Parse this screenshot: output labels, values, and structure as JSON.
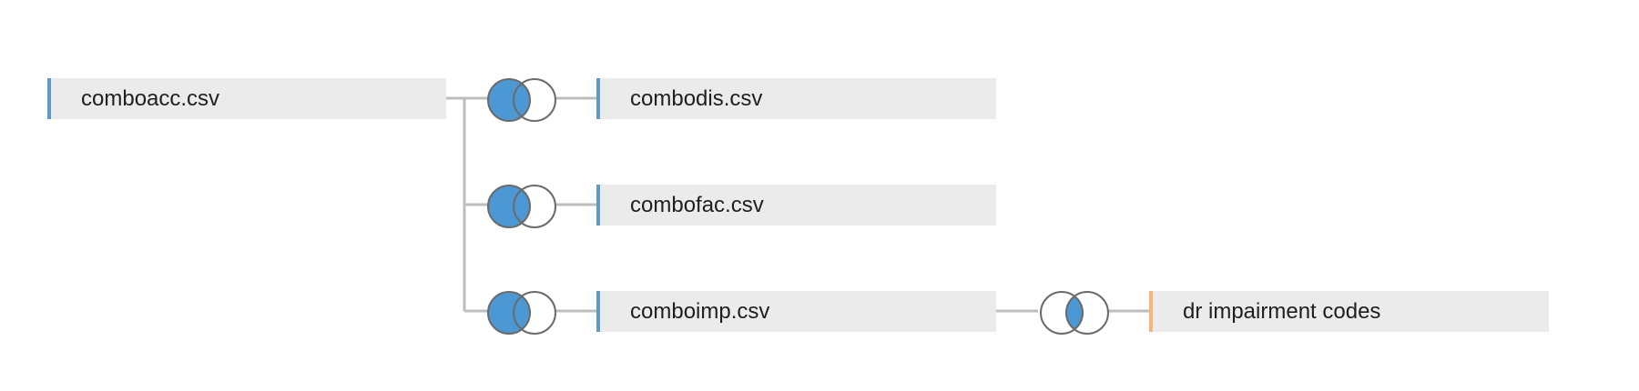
{
  "tables": [
    {
      "id": "comboacc",
      "name": "comboacc.csv",
      "kind": "csv"
    },
    {
      "id": "combodis",
      "name": "combodis.csv",
      "kind": "csv"
    },
    {
      "id": "combofac",
      "name": "combofac.csv",
      "kind": "csv"
    },
    {
      "id": "comboimp",
      "name": "comboimp.csv",
      "kind": "csv"
    },
    {
      "id": "dr-impairment-codes",
      "name": "dr impairment codes",
      "kind": "other"
    }
  ],
  "joins": [
    {
      "left": "comboacc",
      "right": "combodis",
      "type": "left-join",
      "icon": "left-join-icon"
    },
    {
      "left": "comboacc",
      "right": "combofac",
      "type": "left-join",
      "icon": "left-join-icon"
    },
    {
      "left": "comboacc",
      "right": "comboimp",
      "type": "left-join",
      "icon": "left-join-icon"
    },
    {
      "left": "comboimp",
      "right": "dr-impairment-codes",
      "type": "inner-join",
      "icon": "inner-join-icon"
    }
  ],
  "colors": {
    "csv_accent": "#5b9bc7",
    "other_accent": "#f3b779",
    "join_fill": "#4b98d4",
    "join_stroke": "#6b6b6b",
    "connector": "#bdbdbd",
    "node_bg": "#ebebeb"
  }
}
